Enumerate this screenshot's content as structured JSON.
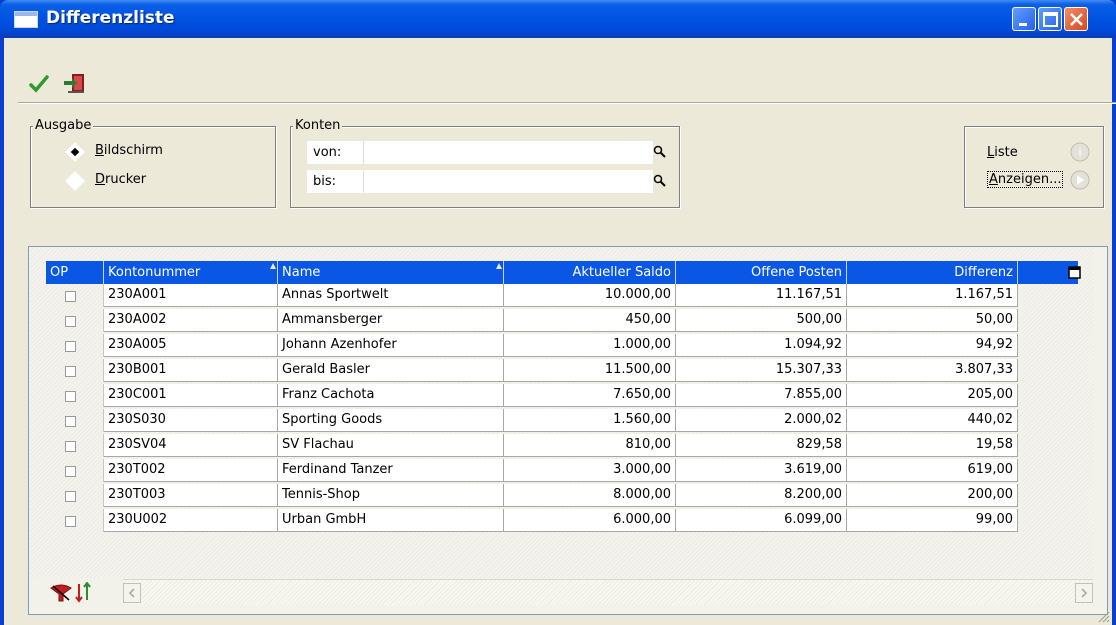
{
  "window": {
    "title": "Differenzliste"
  },
  "toolbar": {
    "ok_icon": "checkmark-icon",
    "exit_icon": "exit-door-icon"
  },
  "ausgabe": {
    "legend": "Ausgabe",
    "options": [
      {
        "label": "Bildschirm",
        "underline": "B",
        "rest": "ildschirm",
        "selected": true
      },
      {
        "label": "Drucker",
        "underline": "D",
        "rest": "rucker",
        "selected": false
      }
    ]
  },
  "konten": {
    "legend": "Konten",
    "von_label": "von:",
    "bis_label": "bis:",
    "von_value": "",
    "bis_value": ""
  },
  "actions": {
    "liste_underline": "L",
    "liste_rest": "iste",
    "anzeigen_underline": "A",
    "anzeigen_rest": "nzeigen..."
  },
  "grid": {
    "columns": [
      "OP",
      "Kontonummer",
      "Name",
      "Aktueller Saldo",
      "Offene Posten",
      "Differenz"
    ],
    "rows": [
      {
        "kontonummer": "230A001",
        "name": "Annas Sportwelt",
        "saldo": "10.000,00",
        "offene_posten": "11.167,51",
        "differenz": "1.167,51"
      },
      {
        "kontonummer": "230A002",
        "name": "Ammansberger",
        "saldo": "450,00",
        "offene_posten": "500,00",
        "differenz": "50,00"
      },
      {
        "kontonummer": "230A005",
        "name": "Johann Azenhofer",
        "saldo": "1.000,00",
        "offene_posten": "1.094,92",
        "differenz": "94,92"
      },
      {
        "kontonummer": "230B001",
        "name": "Gerald Basler",
        "saldo": "11.500,00",
        "offene_posten": "15.307,33",
        "differenz": "3.807,33"
      },
      {
        "kontonummer": "230C001",
        "name": "Franz Cachota",
        "saldo": "7.650,00",
        "offene_posten": "7.855,00",
        "differenz": "205,00"
      },
      {
        "kontonummer": "230S030",
        "name": "Sporting Goods",
        "saldo": "1.560,00",
        "offene_posten": "2.000,02",
        "differenz": "440,02"
      },
      {
        "kontonummer": "230SV04",
        "name": "SV Flachau",
        "saldo": "810,00",
        "offene_posten": "829,58",
        "differenz": "19,58"
      },
      {
        "kontonummer": "230T002",
        "name": "Ferdinand Tanzer",
        "saldo": "3.000,00",
        "offene_posten": "3.619,00",
        "differenz": "619,00"
      },
      {
        "kontonummer": "230T003",
        "name": "Tennis-Shop",
        "saldo": "8.000,00",
        "offene_posten": "8.200,00",
        "differenz": "200,00"
      },
      {
        "kontonummer": "230U002",
        "name": "Urban GmbH",
        "saldo": "6.000,00",
        "offene_posten": "6.099,00",
        "differenz": "99,00"
      }
    ]
  }
}
